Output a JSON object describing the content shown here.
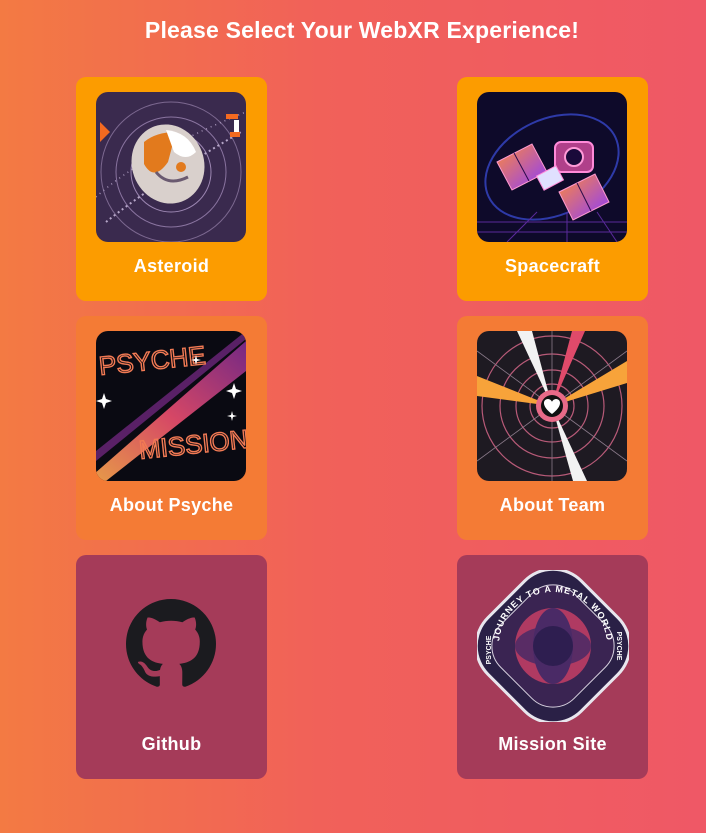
{
  "page": {
    "title": "Please Select Your WebXR Experience!"
  },
  "cards": [
    {
      "id": "asteroid",
      "label": "Asteroid",
      "icon": "asteroid-image",
      "color": "#fc9c00"
    },
    {
      "id": "spacecraft",
      "label": "Spacecraft",
      "icon": "spacecraft-image",
      "color": "#fc9c00"
    },
    {
      "id": "psyche",
      "label": "About Psyche",
      "icon": "psyche-mission-image",
      "color": "#f47b35"
    },
    {
      "id": "team",
      "label": "About Team",
      "icon": "heart-burst-image",
      "color": "#f47b35"
    },
    {
      "id": "github",
      "label": "Github",
      "icon": "github-icon",
      "color": "#a53b59"
    },
    {
      "id": "mission",
      "label": "Mission Site",
      "icon": "psyche-badge-icon",
      "color": "#a53b59"
    }
  ],
  "artwork": {
    "psyche_text_top": "PSYCHE",
    "psyche_text_bottom": "MISSION",
    "badge_text_top": "JOURNEY TO A METAL WORLD",
    "badge_text_left": "PSYCHE",
    "badge_text_right": "PSYCHE"
  },
  "colors": {
    "background_start": "#f37a43",
    "background_end": "#ef5866",
    "card_yellow": "#fc9c00",
    "card_orange": "#f47b35",
    "card_plum": "#a53b59"
  }
}
